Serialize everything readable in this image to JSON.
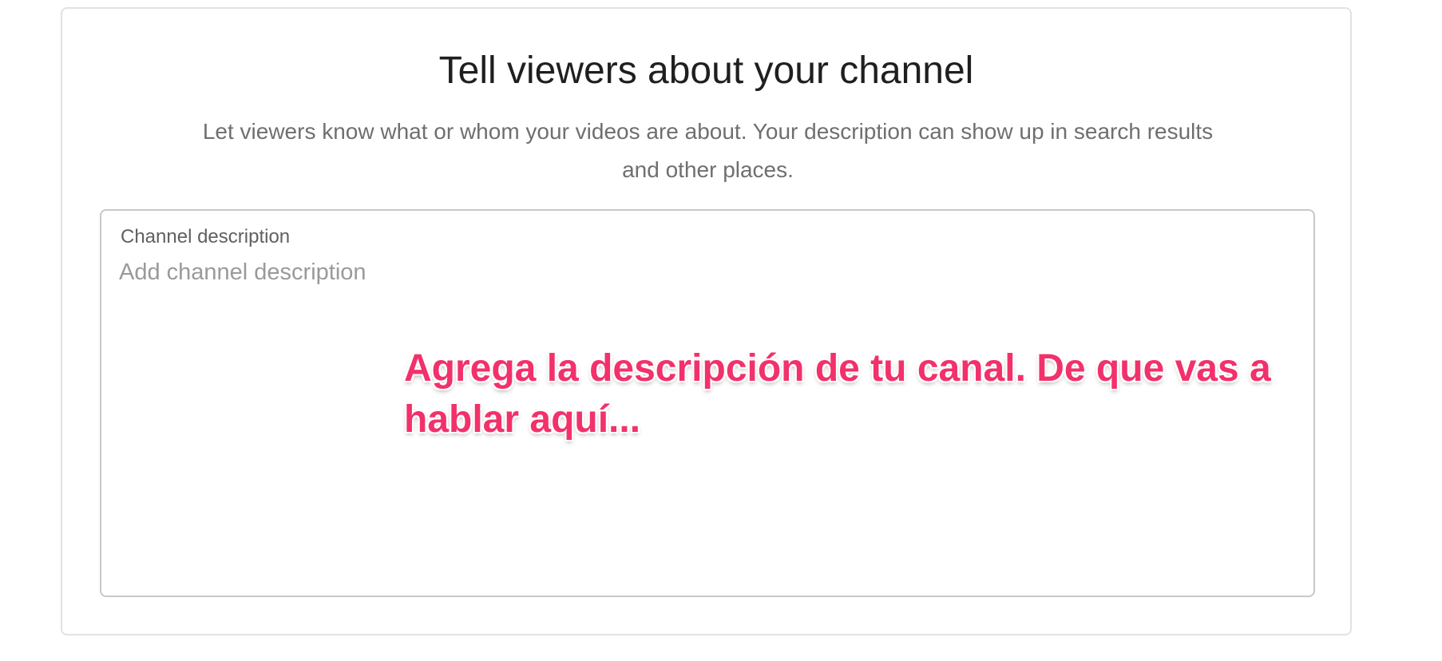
{
  "header": {
    "title": "Tell viewers about your channel",
    "subtitle": "Let viewers know what or whom your videos are about. Your description can show up in search results and other places."
  },
  "description_field": {
    "label": "Channel description",
    "value": "",
    "placeholder": "Add channel description"
  },
  "annotation": {
    "text": "Agrega la descripción de tu canal. De que vas a hablar aquí...",
    "color": "#f2316b"
  },
  "colors": {
    "title": "#1f1f1f",
    "subtitle": "#6f6f6f",
    "field_border": "#c8c8c8",
    "placeholder": "#9a9a9a"
  }
}
